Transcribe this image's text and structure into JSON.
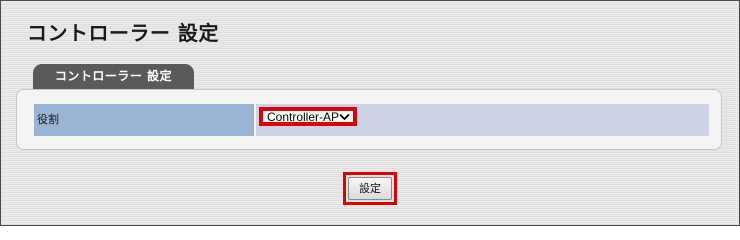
{
  "page": {
    "title": "コントローラー 設定"
  },
  "section": {
    "tab_label": "コントローラー 設定"
  },
  "settings": {
    "rows": [
      {
        "label": "役割",
        "control": "select",
        "selected_value": "Controller-AP",
        "icon": "chevron-down-icon"
      }
    ]
  },
  "actions": {
    "submit_label": "設定"
  },
  "colors": {
    "highlight": "#e00000",
    "label_cell": "#9ab4d4",
    "value_cell": "#cdd3e6",
    "tab": "#5a5a5a"
  }
}
